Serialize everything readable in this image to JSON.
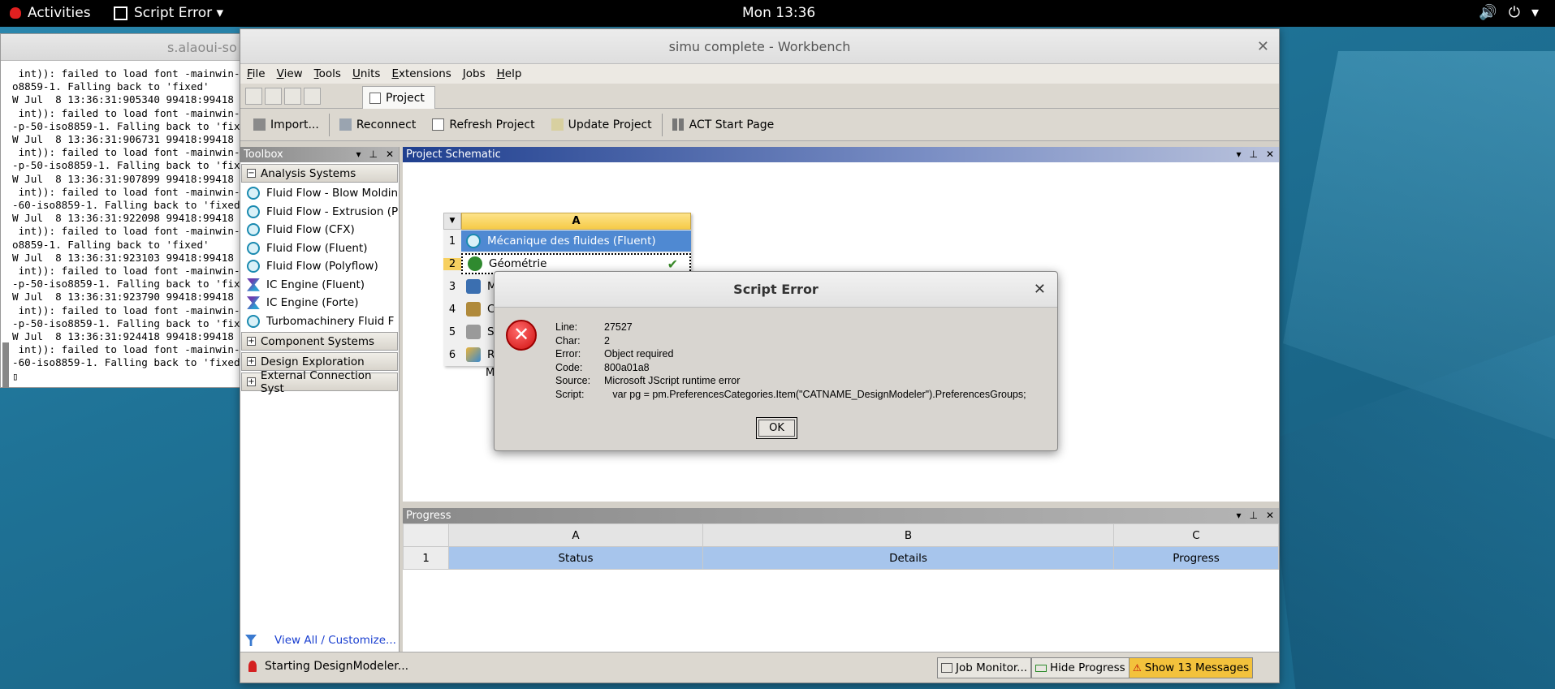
{
  "topbar": {
    "activities": "Activities",
    "app_menu": "Script Error ▾",
    "clock": "Mon 13:36"
  },
  "terminal": {
    "title": "s.alaoui-so",
    "log": " int)): failed to load font -mainwin-\no8859-1. Falling back to 'fixed'\nW Jul  8 13:36:31:905340 99418:99418 \n int)): failed to load font -mainwin-\n-p-50-iso8859-1. Falling back to 'fix\nW Jul  8 13:36:31:906731 99418:99418 \n int)): failed to load font -mainwin-\n-p-50-iso8859-1. Falling back to 'fix\nW Jul  8 13:36:31:907899 99418:99418 \n int)): failed to load font -mainwin-\n-60-iso8859-1. Falling back to 'fixed\nW Jul  8 13:36:31:922098 99418:99418 \n int)): failed to load font -mainwin-\no8859-1. Falling back to 'fixed'\nW Jul  8 13:36:31:923103 99418:99418 \n int)): failed to load font -mainwin-\n-p-50-iso8859-1. Falling back to 'fix\nW Jul  8 13:36:31:923790 99418:99418 \n int)): failed to load font -mainwin-\n-p-50-iso8859-1. Falling back to 'fix\nW Jul  8 13:36:31:924418 99418:99418 \n int)): failed to load font -mainwin-\n-60-iso8859-1. Falling back to 'fixed\n▯"
  },
  "workbench": {
    "title": "simu complete - Workbench",
    "menu": [
      "File",
      "View",
      "Tools",
      "Units",
      "Extensions",
      "Jobs",
      "Help"
    ],
    "tab_label": "Project",
    "toolbar": {
      "import": "Import...",
      "reconnect": "Reconnect",
      "refresh": "Refresh Project",
      "update": "Update Project",
      "act": "ACT Start Page"
    },
    "toolbox": {
      "header": "Toolbox",
      "analysis_group": "Analysis Systems",
      "items": [
        {
          "label": "Fluid Flow - Blow Moldin",
          "icon": "fluid-icon"
        },
        {
          "label": "Fluid Flow - Extrusion (P",
          "icon": "fluid-icon"
        },
        {
          "label": "Fluid Flow (CFX)",
          "icon": "fluid-icon"
        },
        {
          "label": "Fluid Flow (Fluent)",
          "icon": "fluid-icon"
        },
        {
          "label": "Fluid Flow (Polyflow)",
          "icon": "fluid-icon"
        },
        {
          "label": "IC Engine (Fluent)",
          "icon": "engine-icon"
        },
        {
          "label": "IC Engine (Forte)",
          "icon": "engine-icon"
        },
        {
          "label": "Turbomachinery Fluid F",
          "icon": "fluid-icon"
        }
      ],
      "groups": [
        "Component Systems",
        "Design Exploration",
        "External Connection Syst"
      ],
      "footer_link": "View All / Customize..."
    },
    "schematic": {
      "header": "Project Schematic",
      "column": "A",
      "rows": [
        {
          "num": "1",
          "label": "Mécanique des fluides (Fluent)"
        },
        {
          "num": "2",
          "label": "Géométrie"
        },
        {
          "num": "3",
          "label": "M"
        },
        {
          "num": "4",
          "label": "C"
        },
        {
          "num": "5",
          "label": "S"
        },
        {
          "num": "6",
          "label": "R"
        }
      ],
      "caption": "M"
    },
    "progress": {
      "header": "Progress",
      "columns": [
        "A",
        "B",
        "C"
      ],
      "row_num": "1",
      "cells": [
        "Status",
        "Details",
        "Progress"
      ]
    },
    "statusbar": {
      "message": "Starting DesignModeler...",
      "job_monitor": "Job Monitor...",
      "hide_progress": "Hide Progress",
      "show_messages": "Show 13 Messages"
    }
  },
  "dialog": {
    "title": "Script Error",
    "fields": [
      {
        "key": "Line:",
        "value": "27527"
      },
      {
        "key": "Char:",
        "value": "2"
      },
      {
        "key": "Error:",
        "value": "Object required"
      },
      {
        "key": "Code:",
        "value": "800a01a8"
      },
      {
        "key": "Source:",
        "value": "Microsoft JScript runtime error"
      },
      {
        "key": "Script:",
        "value": "   var pg = pm.PreferencesCategories.Item(\"CATNAME_DesignModeler\").PreferencesGroups;"
      }
    ],
    "ok": "OK"
  }
}
